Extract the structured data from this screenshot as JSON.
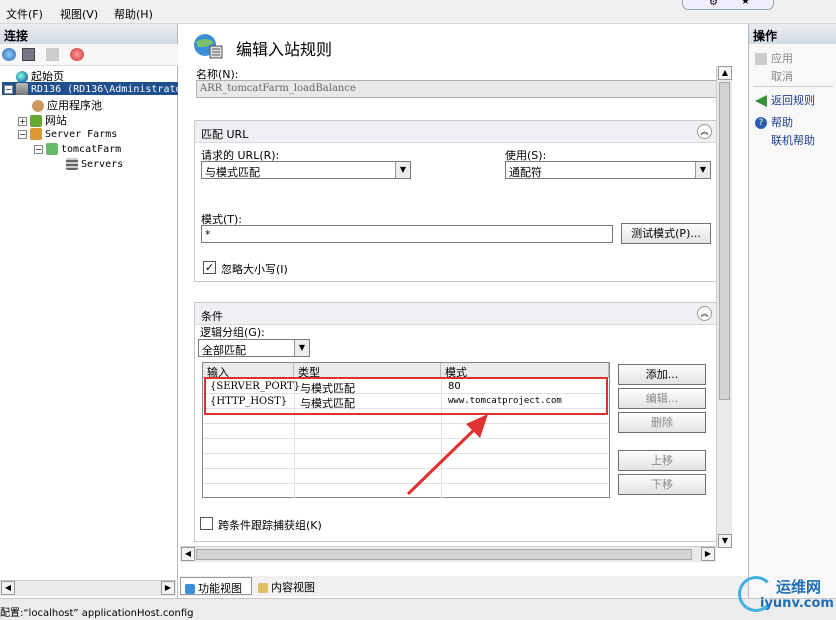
{
  "menubar": {
    "file": "文件(F)",
    "view": "视图(V)",
    "help": "帮助(H)"
  },
  "left": {
    "title": "连接",
    "tree": [
      {
        "label": "起始页"
      },
      {
        "label": "RD136 (RD136\\Administrator"
      },
      {
        "label": "应用程序池"
      },
      {
        "label": "网站"
      },
      {
        "label": "Server Farms"
      },
      {
        "label": "tomcatFarm"
      },
      {
        "label": "Servers"
      }
    ]
  },
  "center": {
    "title": "编辑入站规则",
    "name_label": "名称(N):",
    "name_value": "ARR_tomcatFarm_loadBalance",
    "match_url": {
      "header": "匹配 URL",
      "requested_url_label": "请求的 URL(R):",
      "requested_url_value": "与模式匹配",
      "using_label": "使用(S):",
      "using_value": "通配符",
      "pattern_label": "模式(T):",
      "pattern_value": "*",
      "test_button": "测试模式(P)...",
      "ignore_case_label": "忽略大小写(I)",
      "ignore_case_checked": "✓"
    },
    "conditions": {
      "header": "条件",
      "logical_group_label": "逻辑分组(G):",
      "logical_group_value": "全部匹配",
      "columns": [
        "输入",
        "类型",
        "模式"
      ],
      "rows": [
        {
          "input": "{SERVER_PORT}",
          "type": "与模式匹配",
          "pattern": "80"
        },
        {
          "input": "{HTTP_HOST}",
          "type": "与模式匹配",
          "pattern": "www.tomcatproject.com"
        }
      ],
      "buttons": {
        "add": "添加...",
        "edit": "编辑...",
        "remove": "删除",
        "up": "上移",
        "down": "下移"
      },
      "track_label": "跨条件跟踪捕获组(K)"
    }
  },
  "right": {
    "title": "操作",
    "actions": [
      "应用",
      "取消",
      "返回规则",
      "帮助",
      "联机帮助"
    ]
  },
  "tabs": {
    "features": "功能视图",
    "content": "内容视图"
  },
  "status": "配置:“localhost” applicationHost.config",
  "watermark": {
    "cn": "运维网",
    "url": "iyunv.com"
  },
  "colors": {
    "highlight_box": "#e03030",
    "arrow": "#e03030",
    "selected_node": "#1f4f8f"
  }
}
